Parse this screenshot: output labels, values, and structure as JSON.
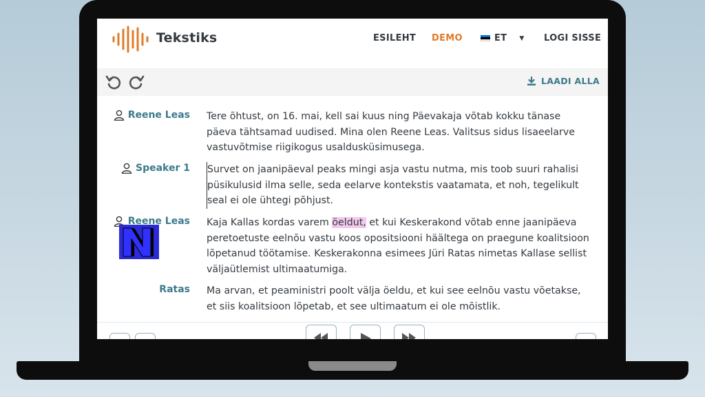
{
  "app": {
    "title": "Tekstiks"
  },
  "nav": {
    "home": "ESILEHT",
    "demo": "DEMO",
    "language": "ET",
    "login": "LOGI SISSE"
  },
  "toolbar": {
    "download_label": "LAADI ALLA"
  },
  "colors": {
    "accent_orange": "#e07b2a",
    "speaker_teal": "#3b7a8c",
    "highlight": "#f3c9ec",
    "text": "#343a40"
  },
  "transcript": {
    "segments": [
      {
        "speaker": "Reene Leas",
        "text": "Tere õhtust, on 16. mai, kell sai kuus ning Päevakaja võtab kokku tänase päeva tähtsamad uudised. Mina olen Reene Leas. Valitsus sidus lisaeelarve vastuvõtmise riigikogus usaldusküsimusega."
      },
      {
        "speaker": "Speaker 1",
        "text": "Survet on jaanipäeval peaks mingi asja vastu nutma, mis toob suuri rahalisi püsikulusid ilma selle, seda eelarve kontekstis vaatamata, et noh, tegelikult seal ei ole ühtegi põhjust."
      },
      {
        "speaker": "Reene Leas",
        "text_before": "Kaja Kallas kordas varem ",
        "text_highlight": "öeldut,",
        "text_after": " et kui Keskerakond võtab enne jaanipäeva peretoetuste eelnõu vastu koos opositsiooni häältega on praegune koalitsioon lõpetanud töötamise. Keskerakonna esimees Jüri Ratas nimetas Kallase sellist väljaütlemist ultimaatumiga."
      },
      {
        "speaker": "Ratas",
        "text": "Ma arvan, et peaministri poolt välja öeldu, et kui see eelnõu vastu võetakse, et siis koalitsioon lõpetab, et see ultimaatum ei ole mõistlik."
      }
    ]
  },
  "overlay": {
    "letter": "N"
  }
}
